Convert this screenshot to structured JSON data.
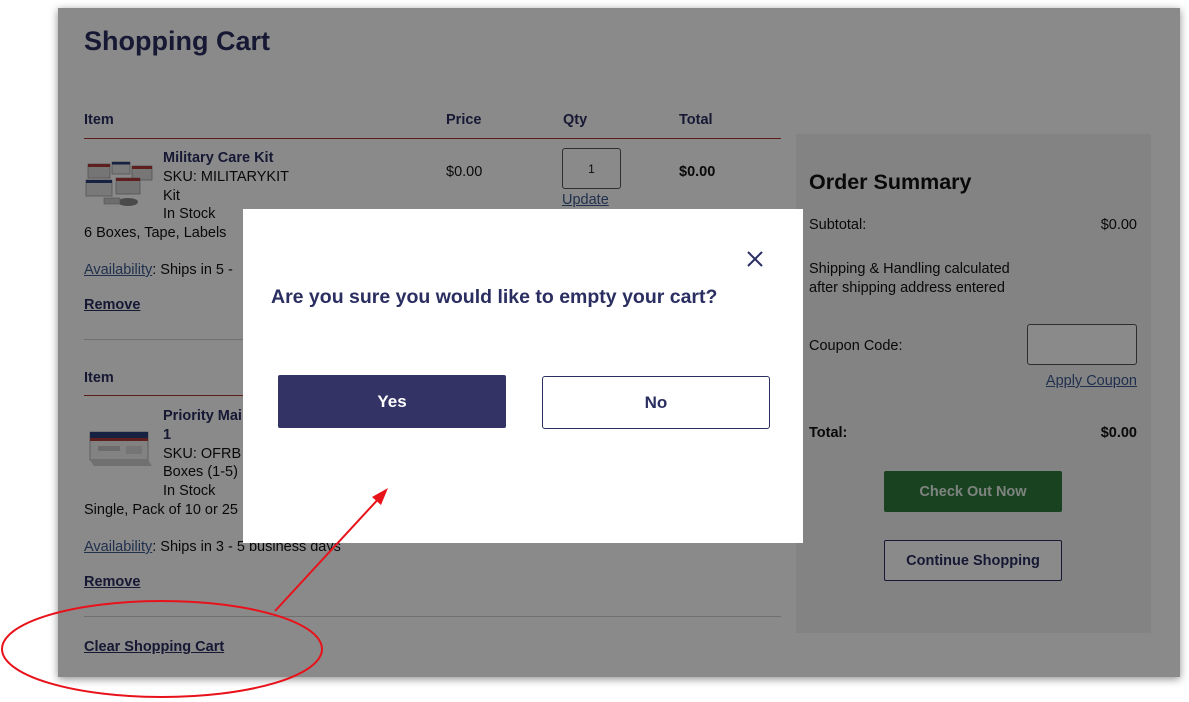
{
  "page": {
    "title": "Shopping Cart"
  },
  "table": {
    "headers": {
      "item": "Item",
      "price": "Price",
      "qty": "Qty",
      "total": "Total"
    },
    "second_header_item": "Item"
  },
  "items": [
    {
      "name": "Military Care Kit",
      "sku_line1": "SKU: MILITARYKIT",
      "sku_line2": "Kit",
      "stock": "In Stock",
      "description": "6 Boxes, Tape, Labels",
      "availability_link": "Availability",
      "availability_text": ": Ships in 5 -",
      "remove": "Remove",
      "price": "$0.00",
      "qty": "1",
      "update": "Update",
      "total": "$0.00"
    },
    {
      "name_line1": "Priority Mai",
      "name_line2": "1",
      "sku_line1": "SKU: OFRB",
      "sku_line2": "Boxes (1-5)",
      "stock": "In Stock",
      "description": "Single, Pack of 10 or 25",
      "availability_link": "Availability",
      "availability_text": ": Ships in 3 - 5 business days",
      "remove": "Remove"
    }
  ],
  "clear_cart": "Clear Shopping Cart",
  "summary": {
    "title": "Order Summary",
    "subtotal_label": "Subtotal:",
    "subtotal_value": "$0.00",
    "shipping_line1": "Shipping & Handling calculated",
    "shipping_line2": "after shipping address entered",
    "coupon_label": "Coupon Code:",
    "coupon_value": "",
    "apply_coupon": "Apply Coupon",
    "total_label": "Total:",
    "total_value": "$0.00",
    "checkout": "Check Out Now",
    "continue": "Continue Shopping"
  },
  "modal": {
    "question": "Are you sure you would like to empty your cart?",
    "yes": "Yes",
    "no": "No",
    "close_icon": "close-icon"
  },
  "colors": {
    "brand_navy": "#2a2e60",
    "yes_button": "#333366",
    "checkout_green": "#2f7a3c",
    "annotation_red": "#e8121b"
  }
}
